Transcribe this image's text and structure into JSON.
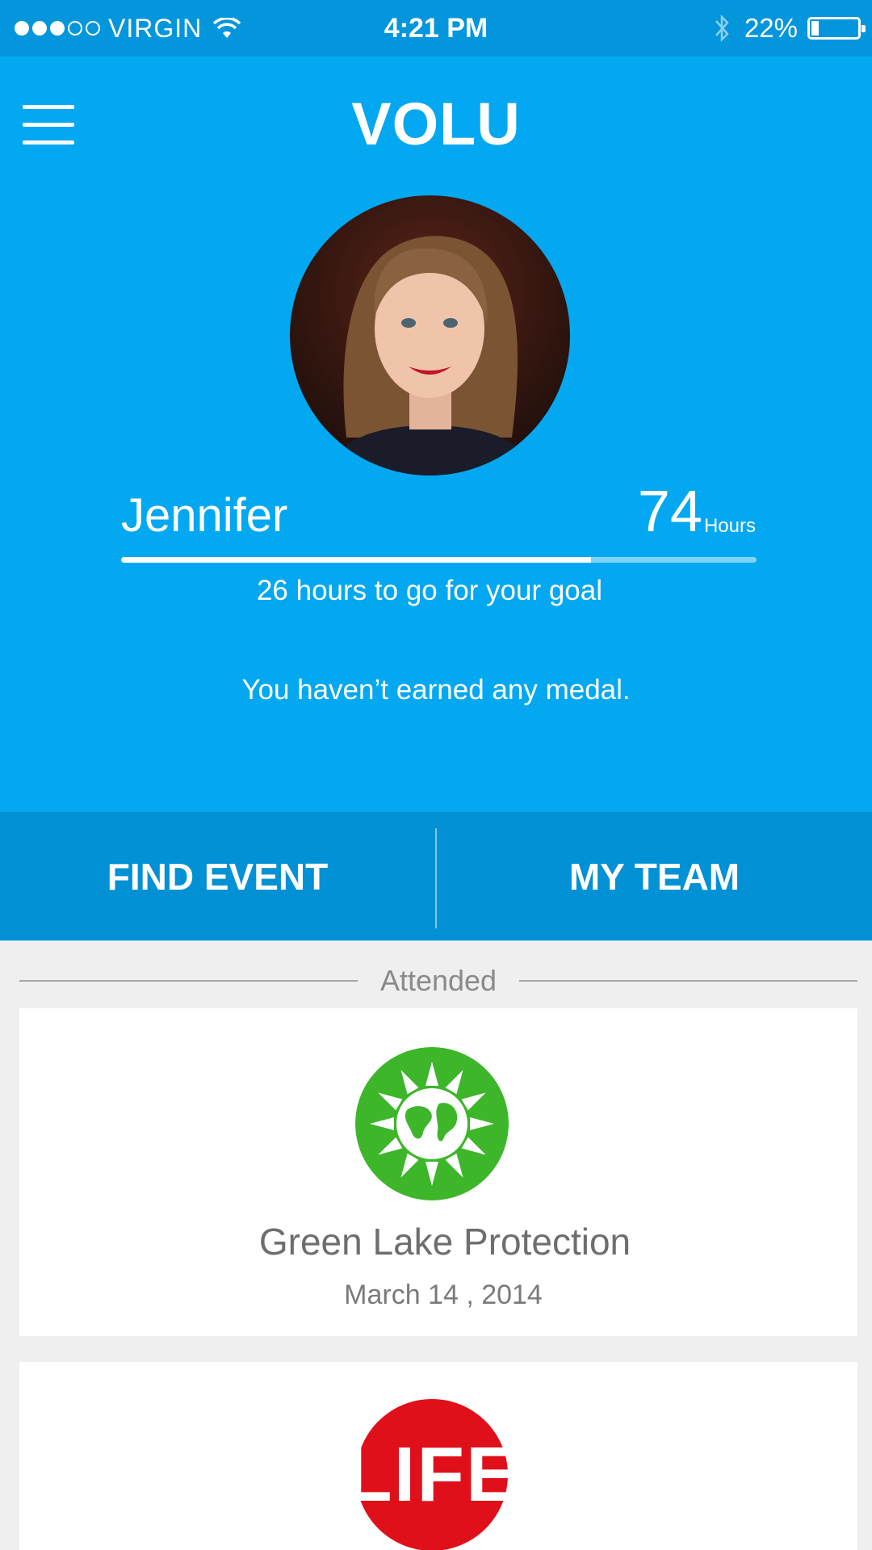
{
  "status_bar": {
    "carrier": "VIRGIN",
    "time": "4:21 PM",
    "battery_percent": "22%",
    "battery_level": 0.22,
    "signal_bars_filled": 3,
    "signal_bars_total": 5,
    "icons": [
      "signal-dots-icon",
      "wifi-icon",
      "bluetooth-icon",
      "battery-icon"
    ]
  },
  "header": {
    "logo": "VOLU",
    "menu_icon": "hamburger-menu-icon"
  },
  "profile": {
    "name": "Jennifer",
    "hours_value": "74",
    "hours_unit": "Hours",
    "goal_progress": 0.74,
    "goal_text": "26 hours to go for your goal",
    "medal_text": "You haven’t earned any medal."
  },
  "actions": {
    "find_event": "FIND EVENT",
    "my_team": "MY TEAM"
  },
  "attended": {
    "section_title": "Attended",
    "events": [
      {
        "title": "Green Lake Protection",
        "date": "March 14 , 2014",
        "logo_icon": "green-earth-sun-logo"
      },
      {
        "title": "",
        "date": "",
        "logo_text": "LIFE",
        "logo_icon": "life-logo"
      }
    ]
  },
  "colors": {
    "status_bar": "#0396dc",
    "hero": "#03a8f0",
    "action_bar": "#0191d4",
    "background": "#efefef",
    "green_logo": "#3db62a",
    "life_logo": "#e0101a"
  }
}
